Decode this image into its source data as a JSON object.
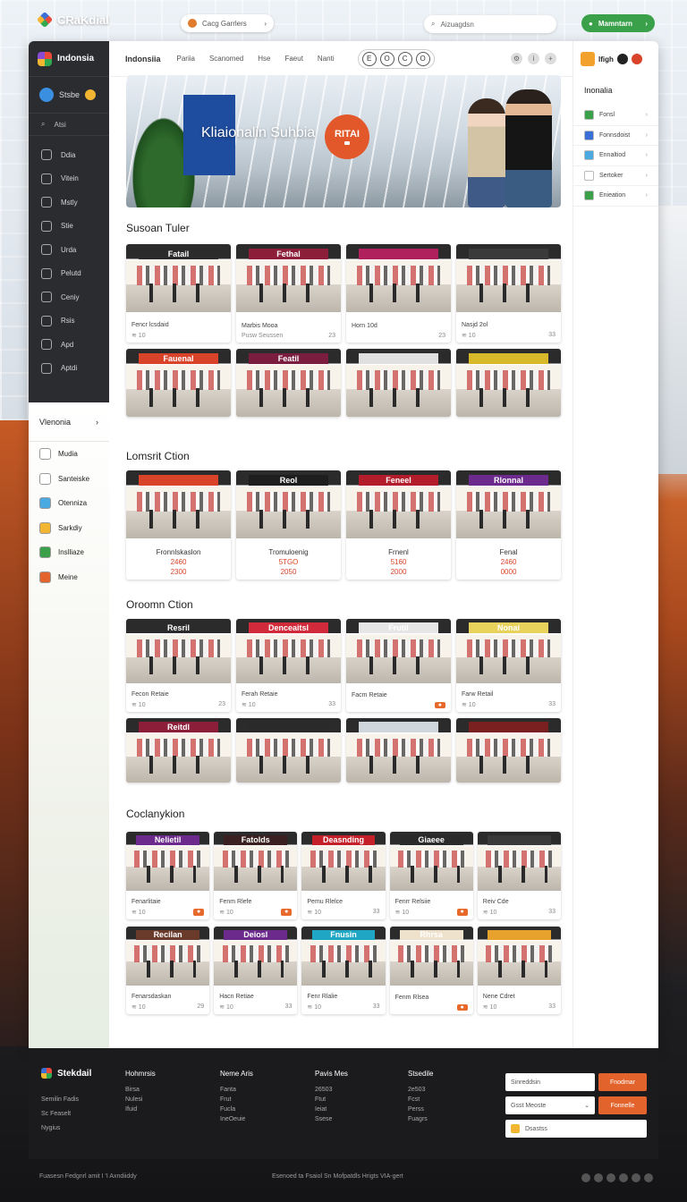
{
  "topbar": {
    "brand": "CRaKdial",
    "pill_label": "Cacg Garrlers",
    "search_placeholder": "Aizuagdsn",
    "cta_label": "Mamntarn"
  },
  "dark_sidebar": {
    "brand": "Indonsia",
    "user": "Stsbe",
    "search": "Atsi",
    "items": [
      "Ddia",
      "Vitein",
      "Mstly",
      "Stie",
      "Urda",
      "Pelutd",
      "Ceniy",
      "Rsis",
      "Apd",
      "Aptdi"
    ]
  },
  "light_sidebar": {
    "header": "Vlenonia",
    "items": [
      {
        "label": "Mudia",
        "color": "#ffffff"
      },
      {
        "label": "Santeiske",
        "color": "#ffffff"
      },
      {
        "label": "Otenniza",
        "color": "#49a9e0"
      },
      {
        "label": "Sarkdiy",
        "color": "#f2b632"
      },
      {
        "label": "Inslliaze",
        "color": "#3aa14a"
      },
      {
        "label": "Meine",
        "color": "#e2642c"
      }
    ]
  },
  "tabs": {
    "title": "Indonsiia",
    "items": [
      "Pariia",
      "Scanomed",
      "Hse",
      "Faeut",
      "Nanti"
    ],
    "chips": [
      "E",
      "O",
      "C",
      "O"
    ]
  },
  "hero": {
    "title": "Kliaionalin Suhbia",
    "badge": "RITAI"
  },
  "sections": [
    {
      "title": "Susoan Tuler"
    },
    {
      "title": "Lomsrit Ction"
    },
    {
      "title": "Oroomn Ction"
    },
    {
      "title": "Coclanykion"
    }
  ],
  "s1_cards": [
    {
      "sign": "Fatail",
      "sign_color": "#2b2b2b",
      "name": "Fencr lcsdaid",
      "meta": "≋ 10",
      "price": "",
      "tag": ""
    },
    {
      "sign": "Fethal",
      "sign_color": "#8c1e3a",
      "name": "Marbis Mooa",
      "meta": "Pusw Seussen",
      "price": "23",
      "tag": ""
    },
    {
      "sign": "",
      "sign_color": "#b0205c",
      "name": "Horn 10d",
      "meta": "",
      "price": "23",
      "tag": ""
    },
    {
      "sign": "",
      "sign_color": "#3a3a3a",
      "name": "Nasjd 2ol",
      "meta": "≋ 10",
      "price": "33",
      "tag": ""
    }
  ],
  "s1b_cards": [
    {
      "sign": "Fauenal",
      "sign_color": "#d9432a"
    },
    {
      "sign": "Featil",
      "sign_color": "#7a1d3f"
    },
    {
      "sign": "",
      "sign_color": "#e0e0e0"
    },
    {
      "sign": "",
      "sign_color": "#d7b92a"
    }
  ],
  "s2_cards": [
    {
      "sign": "",
      "sign_color": "#d9432a",
      "name": "Fronnlskaslon",
      "price1": "2460",
      "price2": "2300"
    },
    {
      "sign": "Reol",
      "sign_color": "#1e1e1e",
      "name": "Tromuloenig",
      "price1": "5TGO",
      "price2": "2050"
    },
    {
      "sign": "Feneel",
      "sign_color": "#b31c2a",
      "name": "Frnenl",
      "price1": "5160",
      "price2": "2000"
    },
    {
      "sign": "Rlonnal",
      "sign_color": "#6b2a8c",
      "name": "Fenal",
      "price1": "2460",
      "price2": "0000"
    }
  ],
  "s3_cards": [
    {
      "sign": "Resril",
      "sign_color": "#2b2b2b",
      "name": "Fecon Retaie",
      "meta": "≋ 10",
      "price": "23",
      "tag": ""
    },
    {
      "sign": "Denceaitsl",
      "sign_color": "#d12a3a",
      "name": "Ferah Retaie",
      "meta": "≋ 10",
      "price": "33",
      "tag": ""
    },
    {
      "sign": "Frutil",
      "sign_color": "#e6e6e6",
      "name": "Facm Retaie",
      "meta": "",
      "price": "",
      "tag": "●"
    },
    {
      "sign": "Nonai",
      "sign_color": "#e8d25c",
      "name": "Farw Retail",
      "meta": "≋ 10",
      "price": "33",
      "tag": ""
    }
  ],
  "s3b_cards": [
    {
      "sign": "Reitdl",
      "sign_color": "#8c1e3a"
    },
    {
      "sign": "",
      "sign_color": "#2a2a2a"
    },
    {
      "sign": "",
      "sign_color": "#cfd6dc"
    },
    {
      "sign": "",
      "sign_color": "#7a2020"
    }
  ],
  "s4_cards": [
    {
      "sign": "Nelietil",
      "sign_color": "#6b2a8c",
      "name": "Fenarlitaie",
      "meta": "≋ 10",
      "price": "",
      "tag": "●"
    },
    {
      "sign": "Fatolds",
      "sign_color": "#3a2020",
      "name": "Fenm Rlefe",
      "meta": "≋ 10",
      "price": "",
      "tag": "●"
    },
    {
      "sign": "Deasnding",
      "sign_color": "#c4202a",
      "name": "Pemu Rlelce",
      "meta": "≋ 10",
      "price": "33",
      "tag": ""
    },
    {
      "sign": "Giaeee",
      "sign_color": "#2a2a2a",
      "name": "Fenrr Relsiie",
      "meta": "≋ 10",
      "price": "",
      "tag": "●"
    },
    {
      "sign": "",
      "sign_color": "#3a3a3a",
      "name": "Reiv Cde",
      "meta": "≋ 10",
      "price": "33",
      "tag": ""
    }
  ],
  "s4b_cards": [
    {
      "sign": "Recilan",
      "sign_color": "#6a3a2a",
      "name": "Fenarsdaskan",
      "meta": "≋ 10",
      "price": "29",
      "tag": ""
    },
    {
      "sign": "Deiosl",
      "sign_color": "#6b2a8c",
      "name": "Hacn Retiae",
      "meta": "≋ 10",
      "price": "33",
      "tag": ""
    },
    {
      "sign": "Fnusin",
      "sign_color": "#1ea6c4",
      "name": "Fenr Rlalie",
      "meta": "≋ 10",
      "price": "33",
      "tag": ""
    },
    {
      "sign": "Rhrsa",
      "sign_color": "#efe2cc",
      "name": "Fenm Rlsea",
      "meta": "",
      "price": "",
      "tag": "●"
    },
    {
      "sign": "",
      "sign_color": "#e6a22c",
      "name": "Nene Cdret",
      "meta": "≋ 10",
      "price": "33",
      "tag": ""
    }
  ],
  "right_panel": {
    "top_label": "Ifigh",
    "header": "Inonalia",
    "items": [
      {
        "label": "Fonsl",
        "color": "#3aa14a"
      },
      {
        "label": "Fonnsdoist",
        "color": "#3b6fd8"
      },
      {
        "label": "Ennaltiod",
        "color": "#49a9e0"
      },
      {
        "label": "Sertoker",
        "color": "#ffffff"
      },
      {
        "label": "Enieation",
        "color": "#3aa14a"
      }
    ]
  },
  "footer": {
    "brand": "Stekdail",
    "desc": [
      "Semilin Fadis",
      "Sc Feaselt",
      "Nygius"
    ],
    "cols": [
      {
        "head": "Hohmrsis",
        "items": [
          "Birsa",
          "Nulesi",
          "Ifuid"
        ]
      },
      {
        "head": "Neme Aris",
        "items": [
          "Fanta",
          "Frut",
          "Fucla",
          "IneOeuie"
        ]
      },
      {
        "head": "Pavis Mes",
        "items": [
          "26503",
          "Ftut",
          "Ieiat",
          "Ssese"
        ]
      },
      {
        "head": "Stsedile",
        "items": [
          "2e503",
          "Fcst",
          "Perss",
          "Fuagrs"
        ]
      }
    ],
    "input1": "Sinreddsin",
    "input2": "Gsst Meoste",
    "btn1": "Fnodmar",
    "btn2": "Fonnelle",
    "btn3": "Dsastss",
    "copyright": "Fuasesn Fedgnrl amit I 'I Axndiiddy",
    "links": "Esenoed ta Fsaiol Sn Mofpatdls Hrigts VIA-gert"
  }
}
